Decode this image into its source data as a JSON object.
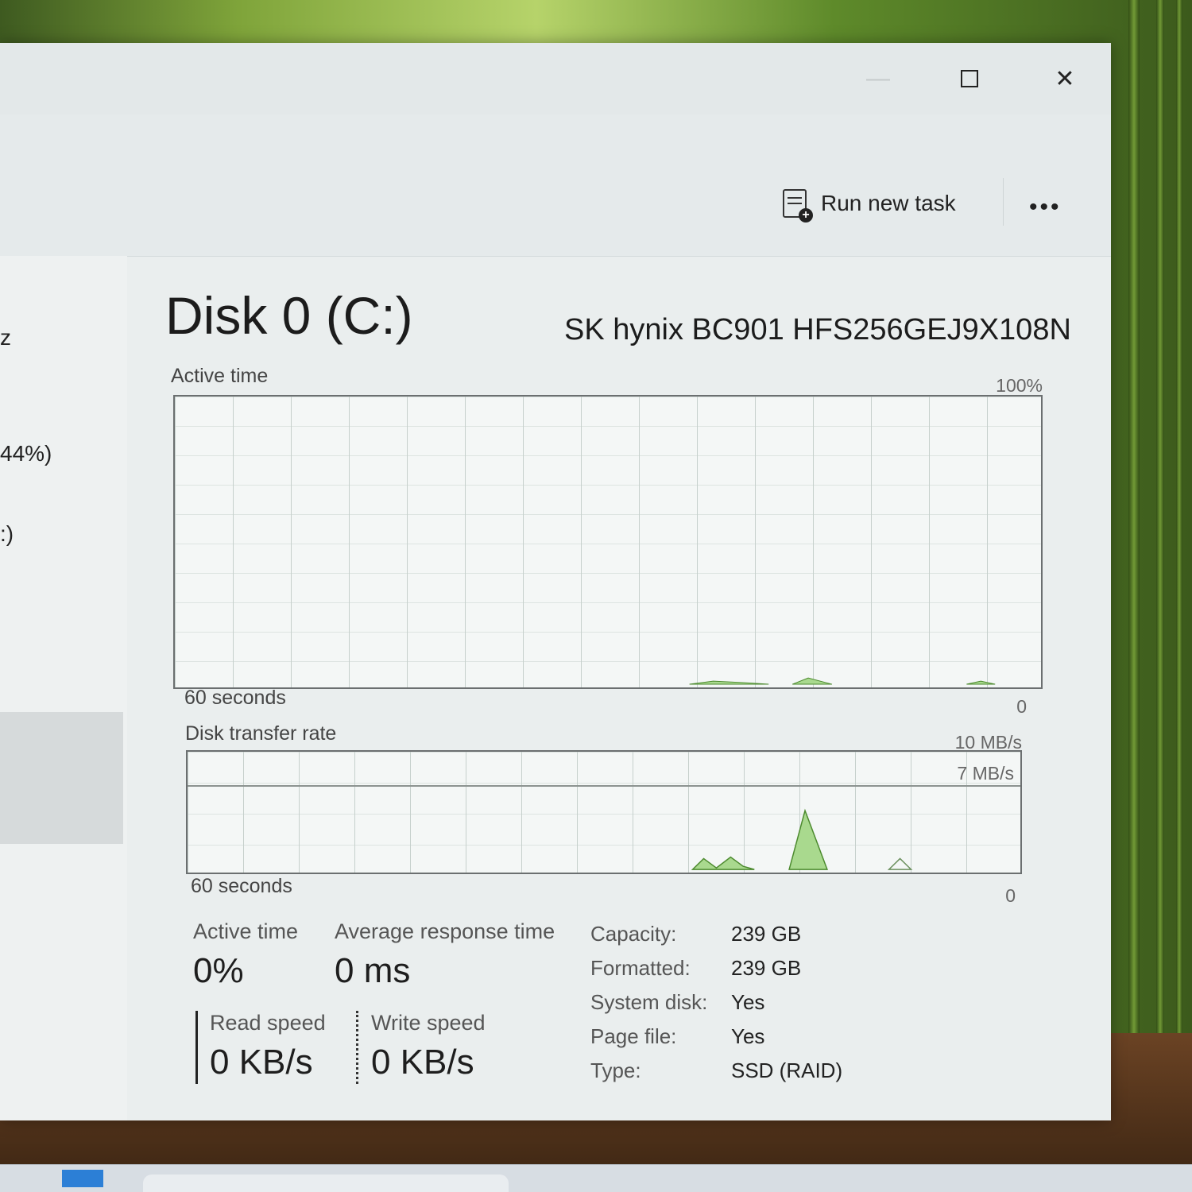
{
  "window": {
    "controls": {
      "minimize": "—",
      "close": "✕"
    }
  },
  "command_bar": {
    "run_new_task": "Run new task",
    "more": "•••"
  },
  "sidebar": {
    "fragments": [
      "z",
      "44%)",
      ":)"
    ]
  },
  "disk": {
    "title": "Disk 0 (C:)",
    "model": "SK hynix BC901 HFS256GEJ9X108N"
  },
  "graphs": {
    "active_time": {
      "label": "Active time",
      "max": "100%",
      "time_span": "60 seconds",
      "min": "0"
    },
    "transfer_rate": {
      "label": "Disk transfer rate",
      "max": "10 MB/s",
      "line_label": "7 MB/s",
      "time_span": "60 seconds",
      "min": "0"
    }
  },
  "stats": {
    "active_time_label": "Active time",
    "active_time_value": "0%",
    "avg_response_label": "Average response time",
    "avg_response_value": "0 ms",
    "read_speed_label": "Read speed",
    "read_speed_value": "0 KB/s",
    "write_speed_label": "Write speed",
    "write_speed_value": "0 KB/s"
  },
  "properties": [
    {
      "key": "Capacity:",
      "value": "239 GB"
    },
    {
      "key": "Formatted:",
      "value": "239 GB"
    },
    {
      "key": "System disk:",
      "value": "Yes"
    },
    {
      "key": "Page file:",
      "value": "Yes"
    },
    {
      "key": "Type:",
      "value": "SSD (RAID)"
    }
  ],
  "colors": {
    "graph_fill": "#a9d98e",
    "graph_stroke": "#4c8a2e"
  }
}
